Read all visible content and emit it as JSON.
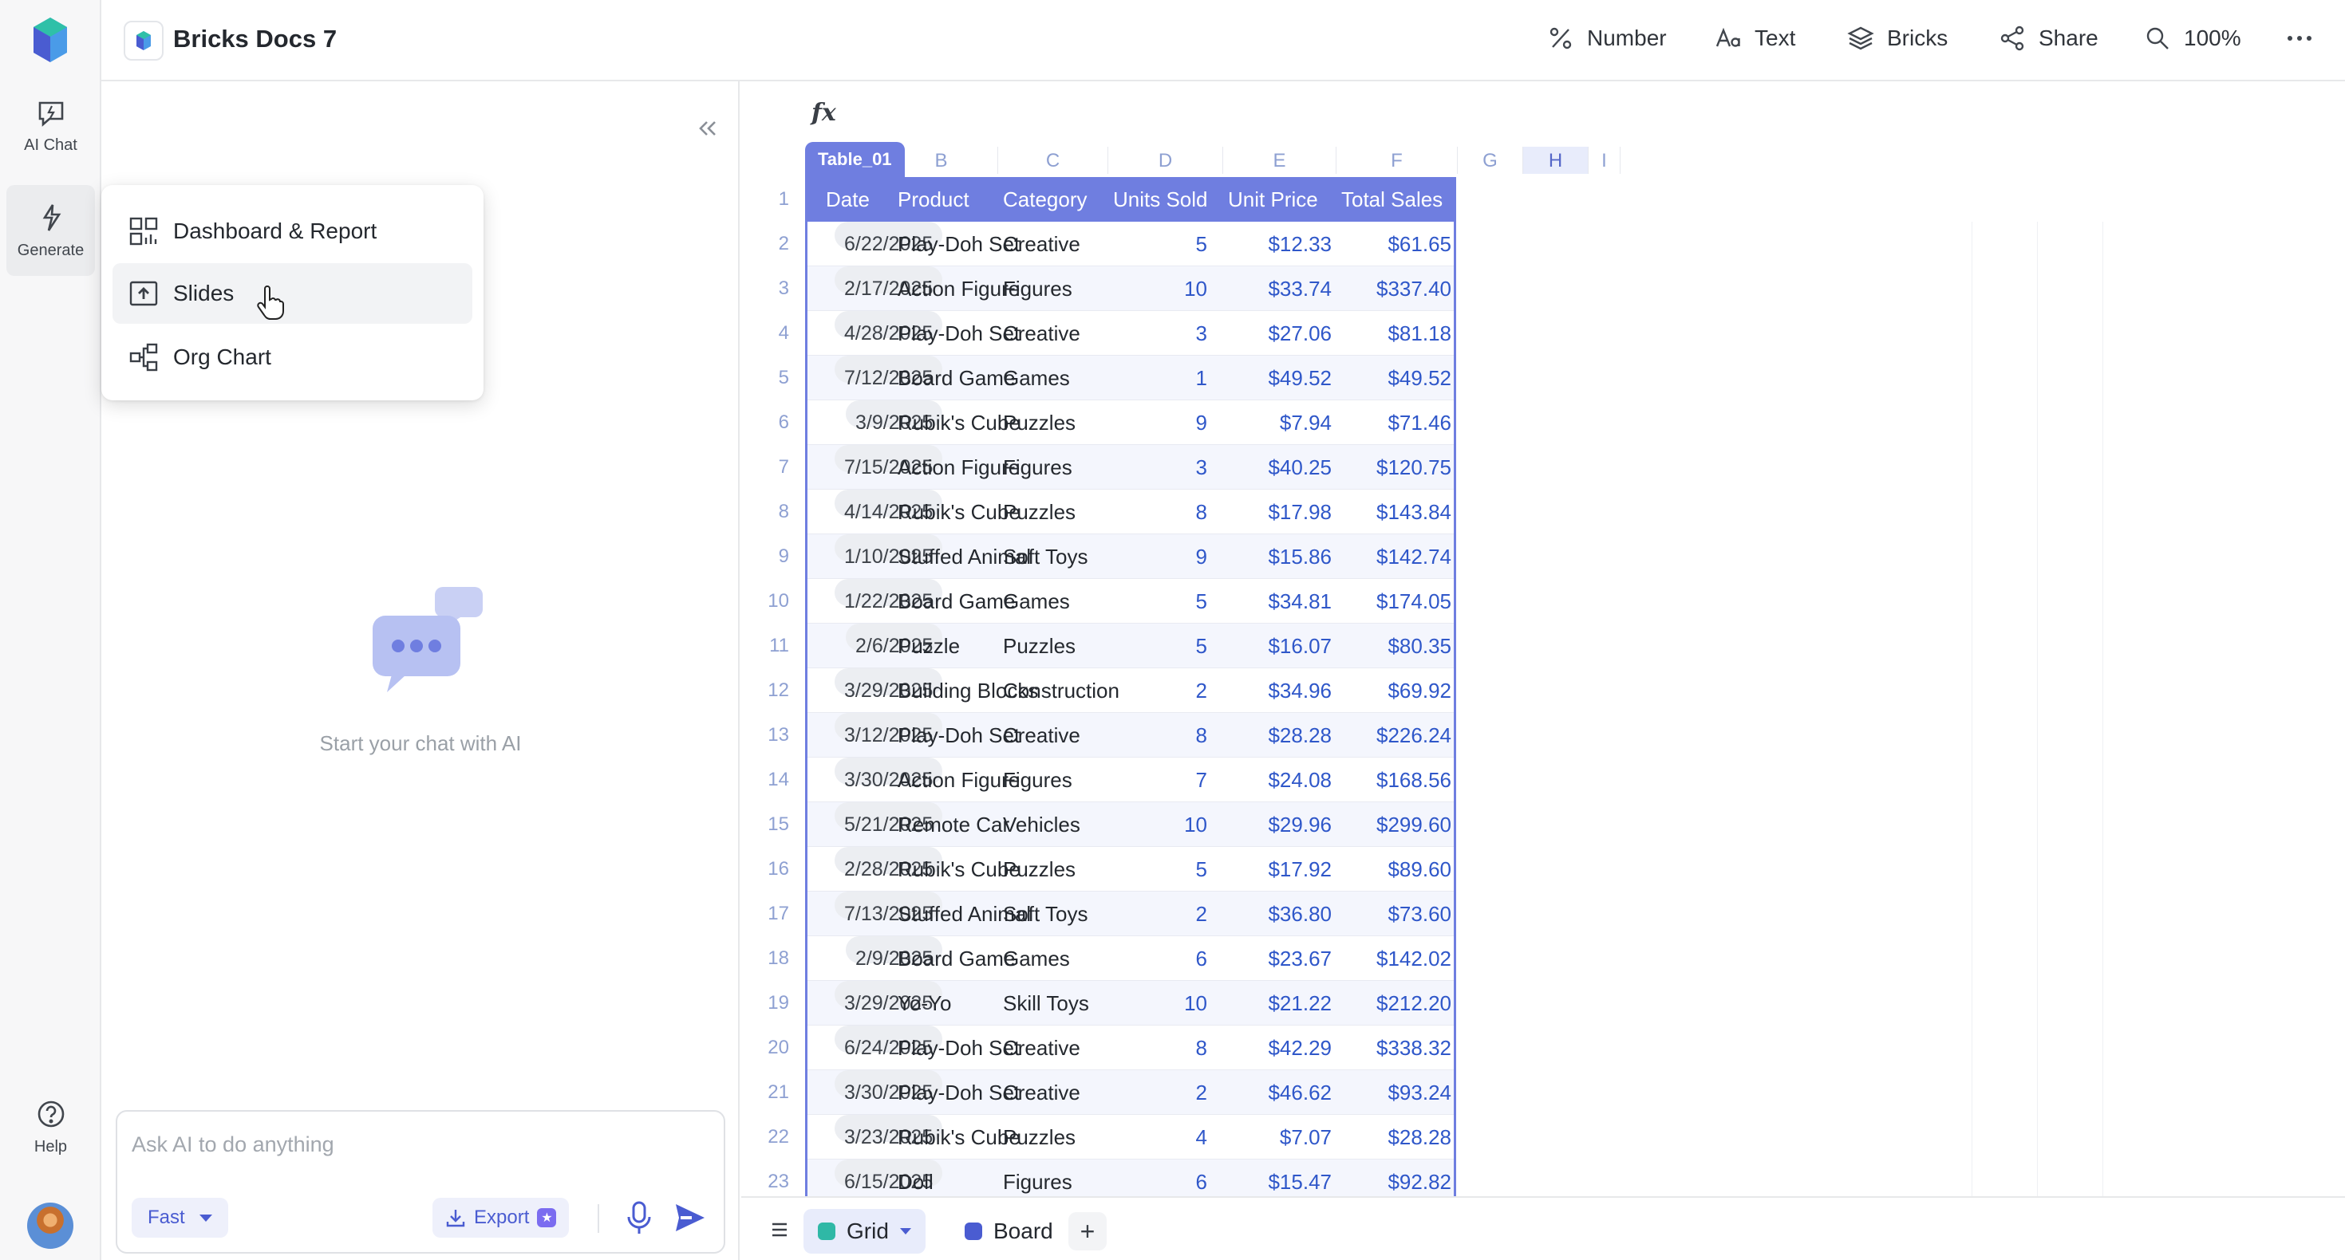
{
  "rail": {
    "ai_chat_label": "AI Chat",
    "generate_label": "Generate",
    "help_label": "Help"
  },
  "topbar": {
    "doc_title": "Bricks Docs 7",
    "number_label": "Number",
    "text_label": "Text",
    "bricks_label": "Bricks",
    "share_label": "Share",
    "zoom_label": "100%"
  },
  "chat": {
    "empty_text": "Start your chat with AI",
    "input_placeholder": "Ask AI to do anything",
    "mode_label": "Fast",
    "export_label": "Export"
  },
  "menu": {
    "items": [
      {
        "label": "Dashboard & Report",
        "icon": "dashboard-icon"
      },
      {
        "label": "Slides",
        "icon": "slides-icon"
      },
      {
        "label": "Org Chart",
        "icon": "org-chart-icon"
      }
    ]
  },
  "sheet": {
    "formula_icon": "fx",
    "table_name": "Table_01",
    "column_letters": [
      "B",
      "C",
      "D",
      "E",
      "F",
      "G",
      "H",
      "I"
    ],
    "headers": [
      "Date",
      "Product",
      "Category",
      "Units Sold",
      "Unit Price",
      "Total Sales"
    ],
    "rows": [
      [
        "6/22/2025",
        "Play-Doh Set",
        "Creative",
        "5",
        "$12.33",
        "$61.65"
      ],
      [
        "2/17/2025",
        "Action Figure",
        "Figures",
        "10",
        "$33.74",
        "$337.40"
      ],
      [
        "4/28/2025",
        "Play-Doh Set",
        "Creative",
        "3",
        "$27.06",
        "$81.18"
      ],
      [
        "7/12/2025",
        "Board Game",
        "Games",
        "1",
        "$49.52",
        "$49.52"
      ],
      [
        "3/9/2025",
        "Rubik's Cube",
        "Puzzles",
        "9",
        "$7.94",
        "$71.46"
      ],
      [
        "7/15/2025",
        "Action Figure",
        "Figures",
        "3",
        "$40.25",
        "$120.75"
      ],
      [
        "4/14/2025",
        "Rubik's Cube",
        "Puzzles",
        "8",
        "$17.98",
        "$143.84"
      ],
      [
        "1/10/2025",
        "Stuffed Animal",
        "Soft Toys",
        "9",
        "$15.86",
        "$142.74"
      ],
      [
        "1/22/2025",
        "Board Game",
        "Games",
        "5",
        "$34.81",
        "$174.05"
      ],
      [
        "2/6/2025",
        "Puzzle",
        "Puzzles",
        "5",
        "$16.07",
        "$80.35"
      ],
      [
        "3/29/2025",
        "Building Blocks",
        "Construction",
        "2",
        "$34.96",
        "$69.92"
      ],
      [
        "3/12/2025",
        "Play-Doh Set",
        "Creative",
        "8",
        "$28.28",
        "$226.24"
      ],
      [
        "3/30/2025",
        "Action Figure",
        "Figures",
        "7",
        "$24.08",
        "$168.56"
      ],
      [
        "5/21/2025",
        "Remote Car",
        "Vehicles",
        "10",
        "$29.96",
        "$299.60"
      ],
      [
        "2/28/2025",
        "Rubik's Cube",
        "Puzzles",
        "5",
        "$17.92",
        "$89.60"
      ],
      [
        "7/13/2025",
        "Stuffed Animal",
        "Soft Toys",
        "2",
        "$36.80",
        "$73.60"
      ],
      [
        "2/9/2025",
        "Board Game",
        "Games",
        "6",
        "$23.67",
        "$142.02"
      ],
      [
        "3/29/2025",
        "Yo-Yo",
        "Skill Toys",
        "10",
        "$21.22",
        "$212.20"
      ],
      [
        "6/24/2025",
        "Play-Doh Set",
        "Creative",
        "8",
        "$42.29",
        "$338.32"
      ],
      [
        "3/30/2025",
        "Play-Doh Set",
        "Creative",
        "2",
        "$46.62",
        "$93.24"
      ],
      [
        "3/23/2025",
        "Rubik's Cube",
        "Puzzles",
        "4",
        "$7.07",
        "$28.28"
      ],
      [
        "6/15/2025",
        "Doll",
        "Figures",
        "6",
        "$15.47",
        "$92.82"
      ]
    ]
  },
  "bottombar": {
    "tabs": [
      {
        "label": "Grid",
        "color": "#2fb8a6"
      },
      {
        "label": "Board",
        "color": "#4a5cd1"
      }
    ],
    "add_label": "+"
  },
  "colors": {
    "accent": "#6f7ee0",
    "link_blue": "#2f57c9"
  }
}
